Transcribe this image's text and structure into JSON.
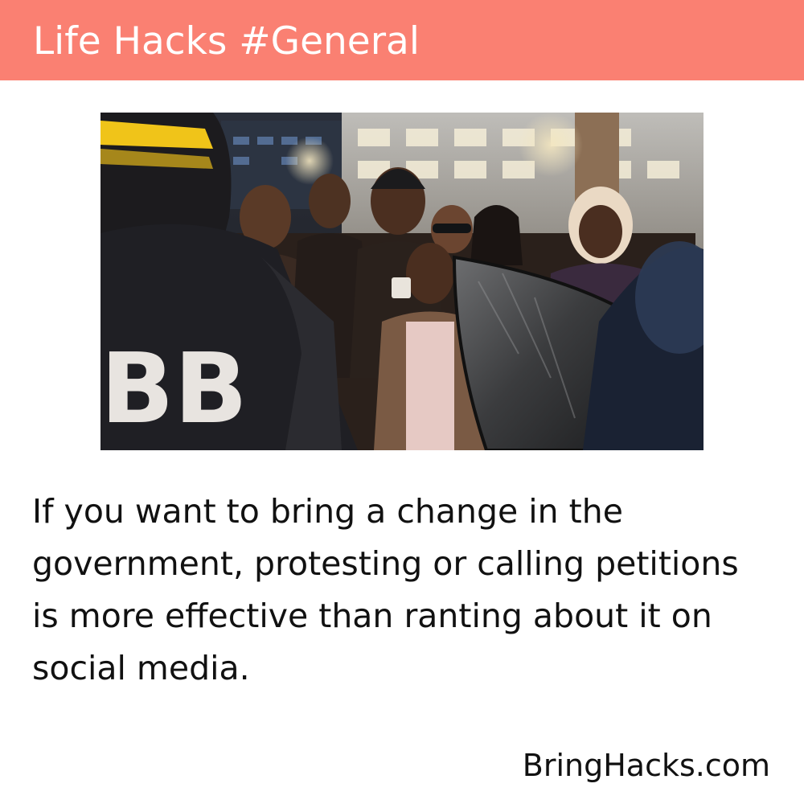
{
  "header": {
    "title": "Life Hacks #General",
    "background_color": "#fa8072"
  },
  "photo": {
    "overlay_text": "BB"
  },
  "body": {
    "text": "If you want to bring a change in the government, protesting or calling petitions is more effective than ranting about it on social media."
  },
  "footer": {
    "site": "BringHacks.com"
  }
}
